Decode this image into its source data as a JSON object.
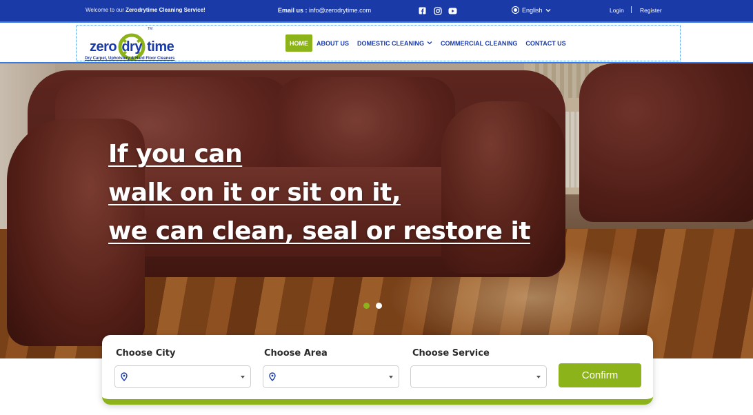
{
  "topbar": {
    "welcome_prefix": "Welcome to our ",
    "welcome_brand": "Zerodrytime Cleaning Service!",
    "email_label": "Email us : ",
    "email_value": "info@zerodrytime.com",
    "social": [
      "facebook-icon",
      "instagram-icon",
      "youtube-icon"
    ],
    "language": "English",
    "login": "Login",
    "register": "Register"
  },
  "logo": {
    "word_left": "zero",
    "word_mid": "dry",
    "word_right": "time",
    "tm": "TM",
    "tagline": "Dry Carpet, Upholstery & Hard Floor Cleaners"
  },
  "nav": {
    "items": [
      {
        "label": "HOME",
        "active": true
      },
      {
        "label": "ABOUT US"
      },
      {
        "label": "DOMESTIC CLEANING",
        "has_dropdown": true
      },
      {
        "label": "COMMERCIAL CLEANING"
      },
      {
        "label": "CONTACT US"
      }
    ]
  },
  "hero": {
    "lines": [
      "If you can",
      "walk on it or sit on it,",
      "we can clean, seal or restore it"
    ],
    "slides": 2,
    "active_slide": 1
  },
  "search": {
    "city_label": "Choose City",
    "area_label": "Choose Area",
    "service_label": "Choose Service",
    "confirm_label": "Confirm"
  },
  "colors": {
    "brand_blue": "#1a3aa8",
    "accent_green": "#8db31b"
  }
}
